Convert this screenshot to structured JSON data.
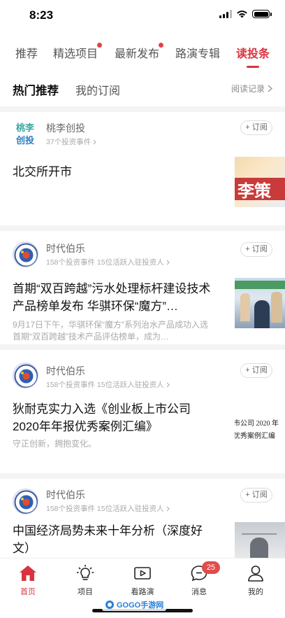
{
  "status_bar": {
    "time": "8:23"
  },
  "top_tabs": [
    {
      "label": "推荐",
      "dot": false,
      "active": false
    },
    {
      "label": "精选项目",
      "dot": true,
      "active": false
    },
    {
      "label": "最新发布",
      "dot": true,
      "active": false
    },
    {
      "label": "路演专辑",
      "dot": false,
      "active": false
    },
    {
      "label": "读投条",
      "dot": false,
      "active": true
    }
  ],
  "sub_tabs": {
    "hot": "热门推荐",
    "subscribed": "我的订阅",
    "read_record": "阅读记录"
  },
  "subscribe_label": "+ 订阅",
  "cards": [
    {
      "avatar_text_1": "桃李",
      "avatar_text_2": "创投",
      "author": "桃李创投",
      "meta": "37个投资事件",
      "title": "北交所开市",
      "summary": "",
      "thumb_text": "李策"
    },
    {
      "author": "时代伯乐",
      "meta": "158个投资事件 15位活跃入驻投资人",
      "title": "首期“双百跨越”污水处理标杆建设技术产品榜单发布  华骐环保“魔方”…",
      "summary": "9月17日下午，华骐环保“魔方”系列治水产品成功入选首期“双百跨越”技术产品评估榜单，成为…"
    },
    {
      "author": "时代伯乐",
      "meta": "158个投资事件 15位活跃入驻投资人",
      "title": "狄耐克实力入选《创业板上市公司2020年年报优秀案例汇编》",
      "summary": "守正创新，拥抱变化。",
      "thumb_line_1": "市公司 2020 年",
      "thumb_line_2": "优秀案例汇编"
    },
    {
      "author": "时代伯乐",
      "meta": "158个投资事件 15位活跃入驻投资人",
      "title": "中国经济局势未来十年分析（深度好文）",
      "summary": ""
    }
  ],
  "bottom_tabs": [
    {
      "label": "首页",
      "icon": "home-icon",
      "active": true
    },
    {
      "label": "项目",
      "icon": "lightbulb-icon",
      "active": false
    },
    {
      "label": "看路演",
      "icon": "video-icon",
      "active": false
    },
    {
      "label": "消息",
      "icon": "message-icon",
      "active": false,
      "badge": "25"
    },
    {
      "label": "我的",
      "icon": "user-icon",
      "active": false
    }
  ],
  "watermark": "GOGO手游网",
  "colors": {
    "accent": "#d9333f",
    "badge": "#e24b4b",
    "background": "#f4f4f4"
  }
}
